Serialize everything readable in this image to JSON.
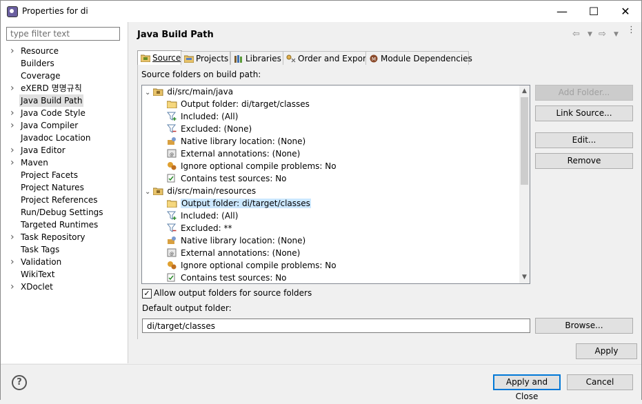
{
  "window": {
    "title": "Properties for di"
  },
  "filter": {
    "placeholder": "type filter text"
  },
  "nav_tree": [
    {
      "label": "Resource",
      "has_children": true
    },
    {
      "label": "Builders",
      "has_children": false
    },
    {
      "label": "Coverage",
      "has_children": false
    },
    {
      "label": "eXERD 명명규칙",
      "has_children": true
    },
    {
      "label": "Java Build Path",
      "has_children": false,
      "selected": true
    },
    {
      "label": "Java Code Style",
      "has_children": true
    },
    {
      "label": "Java Compiler",
      "has_children": true
    },
    {
      "label": "Javadoc Location",
      "has_children": false
    },
    {
      "label": "Java Editor",
      "has_children": true
    },
    {
      "label": "Maven",
      "has_children": true
    },
    {
      "label": "Project Facets",
      "has_children": false
    },
    {
      "label": "Project Natures",
      "has_children": false
    },
    {
      "label": "Project References",
      "has_children": false
    },
    {
      "label": "Run/Debug Settings",
      "has_children": false
    },
    {
      "label": "Targeted Runtimes",
      "has_children": false
    },
    {
      "label": "Task Repository",
      "has_children": true
    },
    {
      "label": "Task Tags",
      "has_children": false
    },
    {
      "label": "Validation",
      "has_children": true
    },
    {
      "label": "WikiText",
      "has_children": false
    },
    {
      "label": "XDoclet",
      "has_children": true
    }
  ],
  "page": {
    "title": "Java Build Path"
  },
  "tabs": [
    {
      "label": "Source",
      "icon": "source-folder-icon",
      "active": true
    },
    {
      "label": "Projects",
      "icon": "projects-icon"
    },
    {
      "label": "Libraries",
      "icon": "libraries-icon"
    },
    {
      "label": "Order and Export",
      "icon": "order-export-icon"
    },
    {
      "label": "Module Dependencies",
      "icon": "module-icon"
    }
  ],
  "source": {
    "folders_label": "Source folders on build path:",
    "folders": [
      {
        "name": "di/src/main/java",
        "children": [
          {
            "label": "Output folder: di/target/classes",
            "icon": "output-folder-icon"
          },
          {
            "label": "Included: (All)",
            "icon": "included-filter-icon"
          },
          {
            "label": "Excluded: (None)",
            "icon": "excluded-filter-icon"
          },
          {
            "label": "Native library location: (None)",
            "icon": "native-library-icon"
          },
          {
            "label": "External annotations: (None)",
            "icon": "annotations-icon"
          },
          {
            "label": "Ignore optional compile problems: No",
            "icon": "ignore-problems-icon"
          },
          {
            "label": "Contains test sources: No",
            "icon": "test-sources-icon"
          }
        ]
      },
      {
        "name": "di/src/main/resources",
        "children": [
          {
            "label": "Output folder: di/target/classes",
            "icon": "output-folder-icon",
            "selected": true
          },
          {
            "label": "Included: (All)",
            "icon": "included-filter-icon"
          },
          {
            "label": "Excluded: **",
            "icon": "excluded-filter-icon"
          },
          {
            "label": "Native library location: (None)",
            "icon": "native-library-icon"
          },
          {
            "label": "External annotations: (None)",
            "icon": "annotations-icon"
          },
          {
            "label": "Ignore optional compile problems: No",
            "icon": "ignore-problems-icon"
          },
          {
            "label": "Contains test sources: No",
            "icon": "test-sources-icon"
          }
        ]
      }
    ],
    "buttons": {
      "add_folder": "Add Folder...",
      "link_source": "Link Source...",
      "edit": "Edit...",
      "remove": "Remove"
    },
    "allow_output_label": "Allow output folders for source folders",
    "allow_output_checked": true,
    "default_output_label": "Default output folder:",
    "default_output_value": "di/target/classes",
    "browse": "Browse..."
  },
  "footer": {
    "apply": "Apply",
    "apply_close": "Apply and Close",
    "cancel": "Cancel"
  }
}
